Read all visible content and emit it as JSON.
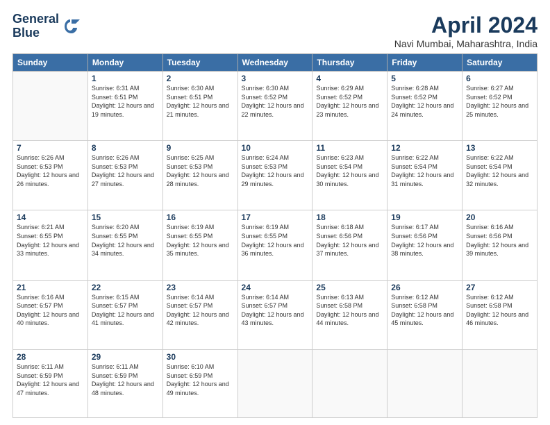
{
  "logo": {
    "line1": "General",
    "line2": "Blue"
  },
  "title": "April 2024",
  "location": "Navi Mumbai, Maharashtra, India",
  "days_of_week": [
    "Sunday",
    "Monday",
    "Tuesday",
    "Wednesday",
    "Thursday",
    "Friday",
    "Saturday"
  ],
  "weeks": [
    [
      {
        "day": "",
        "sunrise": "",
        "sunset": "",
        "daylight": ""
      },
      {
        "day": "1",
        "sunrise": "6:31 AM",
        "sunset": "6:51 PM",
        "daylight": "12 hours and 19 minutes."
      },
      {
        "day": "2",
        "sunrise": "6:30 AM",
        "sunset": "6:51 PM",
        "daylight": "12 hours and 21 minutes."
      },
      {
        "day": "3",
        "sunrise": "6:30 AM",
        "sunset": "6:52 PM",
        "daylight": "12 hours and 22 minutes."
      },
      {
        "day": "4",
        "sunrise": "6:29 AM",
        "sunset": "6:52 PM",
        "daylight": "12 hours and 23 minutes."
      },
      {
        "day": "5",
        "sunrise": "6:28 AM",
        "sunset": "6:52 PM",
        "daylight": "12 hours and 24 minutes."
      },
      {
        "day": "6",
        "sunrise": "6:27 AM",
        "sunset": "6:52 PM",
        "daylight": "12 hours and 25 minutes."
      }
    ],
    [
      {
        "day": "7",
        "sunrise": "6:26 AM",
        "sunset": "6:53 PM",
        "daylight": "12 hours and 26 minutes."
      },
      {
        "day": "8",
        "sunrise": "6:26 AM",
        "sunset": "6:53 PM",
        "daylight": "12 hours and 27 minutes."
      },
      {
        "day": "9",
        "sunrise": "6:25 AM",
        "sunset": "6:53 PM",
        "daylight": "12 hours and 28 minutes."
      },
      {
        "day": "10",
        "sunrise": "6:24 AM",
        "sunset": "6:53 PM",
        "daylight": "12 hours and 29 minutes."
      },
      {
        "day": "11",
        "sunrise": "6:23 AM",
        "sunset": "6:54 PM",
        "daylight": "12 hours and 30 minutes."
      },
      {
        "day": "12",
        "sunrise": "6:22 AM",
        "sunset": "6:54 PM",
        "daylight": "12 hours and 31 minutes."
      },
      {
        "day": "13",
        "sunrise": "6:22 AM",
        "sunset": "6:54 PM",
        "daylight": "12 hours and 32 minutes."
      }
    ],
    [
      {
        "day": "14",
        "sunrise": "6:21 AM",
        "sunset": "6:55 PM",
        "daylight": "12 hours and 33 minutes."
      },
      {
        "day": "15",
        "sunrise": "6:20 AM",
        "sunset": "6:55 PM",
        "daylight": "12 hours and 34 minutes."
      },
      {
        "day": "16",
        "sunrise": "6:19 AM",
        "sunset": "6:55 PM",
        "daylight": "12 hours and 35 minutes."
      },
      {
        "day": "17",
        "sunrise": "6:19 AM",
        "sunset": "6:55 PM",
        "daylight": "12 hours and 36 minutes."
      },
      {
        "day": "18",
        "sunrise": "6:18 AM",
        "sunset": "6:56 PM",
        "daylight": "12 hours and 37 minutes."
      },
      {
        "day": "19",
        "sunrise": "6:17 AM",
        "sunset": "6:56 PM",
        "daylight": "12 hours and 38 minutes."
      },
      {
        "day": "20",
        "sunrise": "6:16 AM",
        "sunset": "6:56 PM",
        "daylight": "12 hours and 39 minutes."
      }
    ],
    [
      {
        "day": "21",
        "sunrise": "6:16 AM",
        "sunset": "6:57 PM",
        "daylight": "12 hours and 40 minutes."
      },
      {
        "day": "22",
        "sunrise": "6:15 AM",
        "sunset": "6:57 PM",
        "daylight": "12 hours and 41 minutes."
      },
      {
        "day": "23",
        "sunrise": "6:14 AM",
        "sunset": "6:57 PM",
        "daylight": "12 hours and 42 minutes."
      },
      {
        "day": "24",
        "sunrise": "6:14 AM",
        "sunset": "6:57 PM",
        "daylight": "12 hours and 43 minutes."
      },
      {
        "day": "25",
        "sunrise": "6:13 AM",
        "sunset": "6:58 PM",
        "daylight": "12 hours and 44 minutes."
      },
      {
        "day": "26",
        "sunrise": "6:12 AM",
        "sunset": "6:58 PM",
        "daylight": "12 hours and 45 minutes."
      },
      {
        "day": "27",
        "sunrise": "6:12 AM",
        "sunset": "6:58 PM",
        "daylight": "12 hours and 46 minutes."
      }
    ],
    [
      {
        "day": "28",
        "sunrise": "6:11 AM",
        "sunset": "6:59 PM",
        "daylight": "12 hours and 47 minutes."
      },
      {
        "day": "29",
        "sunrise": "6:11 AM",
        "sunset": "6:59 PM",
        "daylight": "12 hours and 48 minutes."
      },
      {
        "day": "30",
        "sunrise": "6:10 AM",
        "sunset": "6:59 PM",
        "daylight": "12 hours and 49 minutes."
      },
      {
        "day": "",
        "sunrise": "",
        "sunset": "",
        "daylight": ""
      },
      {
        "day": "",
        "sunrise": "",
        "sunset": "",
        "daylight": ""
      },
      {
        "day": "",
        "sunrise": "",
        "sunset": "",
        "daylight": ""
      },
      {
        "day": "",
        "sunrise": "",
        "sunset": "",
        "daylight": ""
      }
    ]
  ]
}
